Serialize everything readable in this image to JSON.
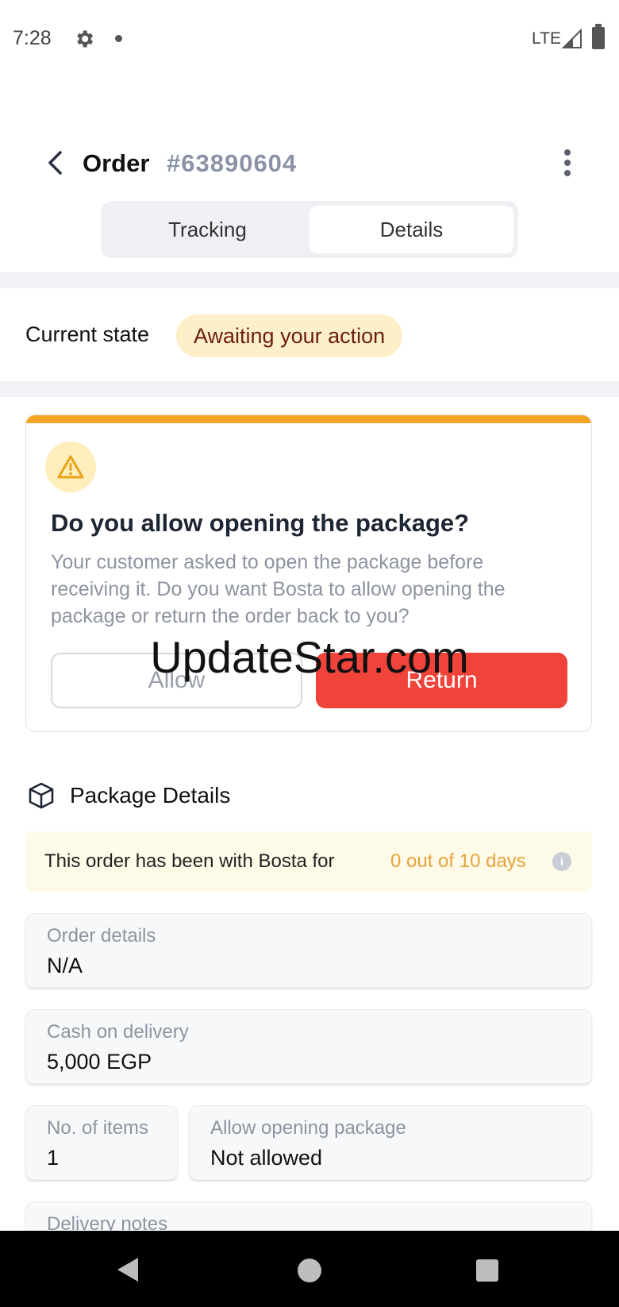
{
  "status_bar": {
    "time": "7:28",
    "network": "LTE"
  },
  "header": {
    "title": "Order",
    "order_number": "#63890604"
  },
  "tabs": [
    {
      "label": "Tracking",
      "active": false
    },
    {
      "label": "Details",
      "active": true
    }
  ],
  "state": {
    "label": "Current state",
    "badge": "Awaiting your action"
  },
  "action_card": {
    "title": "Do you allow opening the package?",
    "description": "Your customer asked to open the package before receiving it. Do you want Bosta to allow opening the package or return the order back to you?",
    "allow_label": "Allow",
    "return_label": "Return",
    "accent_color": "#f4a524",
    "return_color": "#f0433a"
  },
  "watermark": "UpdateStar.com",
  "package": {
    "title": "Package Details",
    "info_text": "This order has been with Bosta for",
    "info_days": "0 out of 10 days"
  },
  "fields": {
    "order_details": {
      "label": "Order details",
      "value": "N/A"
    },
    "cash_on_delivery": {
      "label": "Cash on delivery",
      "value": "5,000 EGP"
    },
    "no_of_items": {
      "label": "No. of items",
      "value": "1"
    },
    "allow_opening": {
      "label": "Allow opening package",
      "value": "Not allowed"
    },
    "delivery_notes": {
      "label": "Delivery notes"
    }
  },
  "icons": {
    "back": "chevron-left-icon",
    "menu": "kebab-menu-icon",
    "warning": "warning-triangle-icon",
    "package": "box-icon",
    "info": "info-icon"
  }
}
